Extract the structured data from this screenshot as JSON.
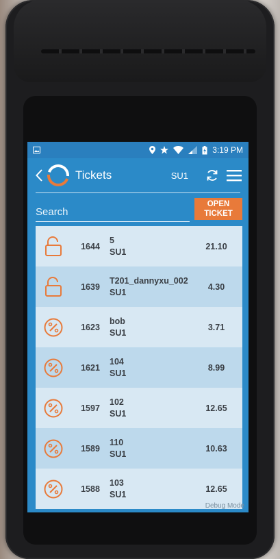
{
  "status_bar": {
    "time": "3:19 PM"
  },
  "header": {
    "title": "Tickets",
    "terminal": "SU1"
  },
  "search": {
    "placeholder": "Search"
  },
  "open_ticket_button": {
    "line1": "OPEN",
    "line2": "TICKET"
  },
  "tickets": [
    {
      "icon": "unlock-icon",
      "number": "1644",
      "name": "5",
      "terminal": "SU1",
      "amount": "21.10"
    },
    {
      "icon": "unlock-icon",
      "number": "1639",
      "name": "T201_dannyxu_002",
      "terminal": "SU1",
      "amount": "4.30"
    },
    {
      "icon": "percent-icon",
      "number": "1623",
      "name": "bob",
      "terminal": "SU1",
      "amount": "3.71"
    },
    {
      "icon": "percent-icon",
      "number": "1621",
      "name": "104",
      "terminal": "SU1",
      "amount": "8.99"
    },
    {
      "icon": "percent-icon",
      "number": "1597",
      "name": "102",
      "terminal": "SU1",
      "amount": "12.65"
    },
    {
      "icon": "percent-icon",
      "number": "1589",
      "name": "110",
      "terminal": "SU1",
      "amount": "10.63"
    },
    {
      "icon": "percent-icon",
      "number": "1588",
      "name": "103",
      "terminal": "SU1",
      "amount": "12.65"
    }
  ],
  "footer": {
    "debug_label": "Debug Mode"
  },
  "colors": {
    "primary_blue": "#2b8ac8",
    "accent_orange": "#e87a3a",
    "row_light": "#d8e8f3",
    "row_dark": "#bdd9ec"
  }
}
